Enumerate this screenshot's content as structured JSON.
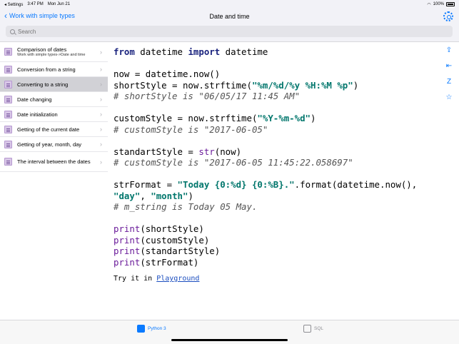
{
  "status": {
    "carrier": "◂ Settings",
    "time": "3:47 PM",
    "date": "Mon Jun 21",
    "battery": "100%"
  },
  "nav": {
    "back_label": "Work with simple types",
    "title": "Date and time"
  },
  "search": {
    "placeholder": "Search"
  },
  "sidebar": {
    "items": [
      {
        "label": "Comparison of dates",
        "sub": "Work with simple types->Date and time"
      },
      {
        "label": "Conversion from a string"
      },
      {
        "label": "Converting to a string"
      },
      {
        "label": "Date changing"
      },
      {
        "label": "Date initialization"
      },
      {
        "label": "Getting of the current date"
      },
      {
        "label": "Getting of year, month, day"
      },
      {
        "label": "The interval between the dates"
      }
    ]
  },
  "code": {
    "l1": [
      "from",
      " datetime ",
      "import",
      " datetime"
    ],
    "l3": "now = datetime.now()",
    "l4a": "shortStyle = now.strftime(",
    "l4s": "\"%m/%d/%y %H:%M %p\"",
    "l4b": ")",
    "l5": "# shortStyle is \"06/05/17 11:45 AM\"",
    "l7a": "customStyle = now.strftime(",
    "l7s": "\"%Y-%m-%d\"",
    "l7b": ")",
    "l8": "# customStyle is \"2017-06-05\"",
    "l10a": "standartStyle = ",
    "l10f": "str",
    "l10b": "(now)",
    "l11": "# customStyle is \"2017-06-05 11:45:22.058697\"",
    "l13a": "strFormat = ",
    "l13s": "\"Today {0:%d} {0:%B}.\"",
    "l13b": ".format(datetime.now(),",
    "l14s1": "\"day\"",
    "l14m": ", ",
    "l14s2": "\"month\"",
    "l14b": ")",
    "l15": "# m_string is Today 05 May.",
    "p1": "shortStyle",
    "p2": "customStyle",
    "p3": "standartStyle",
    "p4": "strFormat",
    "print": "print"
  },
  "try": {
    "prefix": "Try it in ",
    "link": "Playground"
  },
  "tabs": [
    {
      "label": "Python 3"
    },
    {
      "label": "SQL"
    }
  ],
  "colors": {
    "accent": "#0a7aff",
    "selected_row": "#d1d1d6"
  },
  "icons": {
    "share": "share-icon",
    "collapse": "collapse-icon",
    "sort": "sort-icon",
    "favorite": "star-icon"
  }
}
